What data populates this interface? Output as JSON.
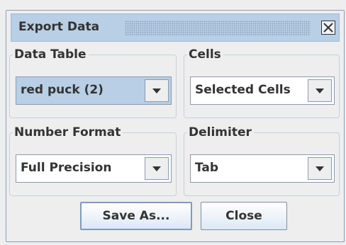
{
  "dialog": {
    "title": "Export Data"
  },
  "groups": {
    "data_table": {
      "label": "Data Table",
      "value": "red puck (2)"
    },
    "cells": {
      "label": "Cells",
      "value": "Selected Cells"
    },
    "number_format": {
      "label": "Number Format",
      "value": "Full Precision"
    },
    "delimiter": {
      "label": "Delimiter",
      "value": "Tab"
    }
  },
  "buttons": {
    "save_as": "Save As...",
    "close": "Close"
  },
  "icons": {
    "close": "close-icon",
    "dropdown": "chevron-down-icon"
  },
  "colors": {
    "titlebar": "#b8cfe5",
    "selection": "#b8cfe5",
    "window_bg": "#eeeeee",
    "text": "#333333"
  }
}
